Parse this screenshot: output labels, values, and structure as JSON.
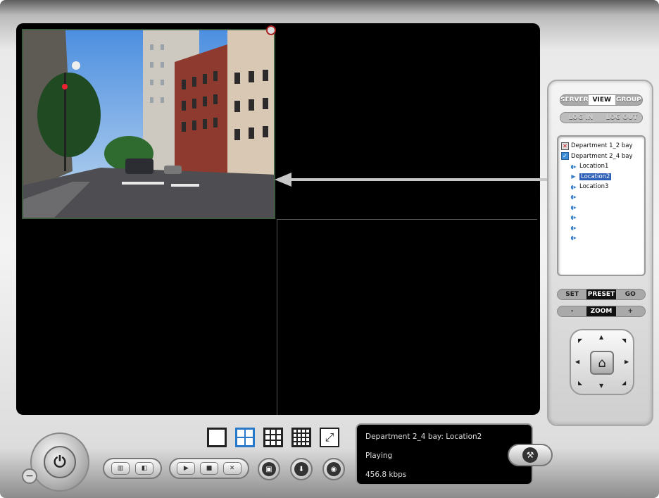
{
  "server_tabs": [
    "SERVER",
    "VIEW",
    "GROUP"
  ],
  "auth_buttons": [
    "LOG IN",
    "LOG OUT"
  ],
  "tree": {
    "groups": [
      {
        "label": "Department 1_2 bay",
        "icon": "error-x-icon"
      },
      {
        "label": "Department 2_4 bay",
        "icon": "check-icon"
      }
    ],
    "cameras": [
      "Location1",
      "Location2",
      "Location3"
    ],
    "selected_camera": "Location2",
    "empty_slots": 5
  },
  "preset_buttons": [
    "SET",
    "PRESET",
    "GO"
  ],
  "zoom_buttons": [
    "-",
    "ZOOM",
    "+"
  ],
  "status": {
    "camera": "Department 2_4 bay: Location2",
    "state": "Playing",
    "bitrate": "456.8 kbps"
  },
  "colors": {
    "accent": "#2a79c9",
    "selection": "#2c5fb6",
    "video_bg": "#000000"
  }
}
